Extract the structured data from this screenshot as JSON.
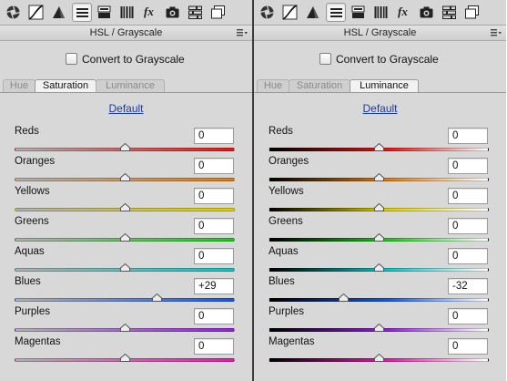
{
  "panels": [
    {
      "id": "left",
      "title": "HSL / Grayscale",
      "convert_label": "Convert to Grayscale",
      "tabs": [
        "Hue",
        "Saturation",
        "Luminance"
      ],
      "active_tab": "Saturation",
      "default_label": "Default",
      "track_style": "saturation",
      "sliders": [
        {
          "label": "Reds",
          "value": "0",
          "fraction": 0.5,
          "hue": "red",
          "color": "#e01818"
        },
        {
          "label": "Oranges",
          "value": "0",
          "fraction": 0.5,
          "hue": "orange",
          "color": "#e07d12"
        },
        {
          "label": "Yellows",
          "value": "0",
          "fraction": 0.5,
          "hue": "yellow",
          "color": "#e0d000"
        },
        {
          "label": "Greens",
          "value": "0",
          "fraction": 0.5,
          "hue": "green",
          "color": "#1cc81c"
        },
        {
          "label": "Aquas",
          "value": "0",
          "fraction": 0.5,
          "hue": "aqua",
          "color": "#12c2c2"
        },
        {
          "label": "Blues",
          "value": "+29",
          "fraction": 0.645,
          "hue": "blue",
          "color": "#1858e0"
        },
        {
          "label": "Purples",
          "value": "0",
          "fraction": 0.5,
          "hue": "purple",
          "color": "#9020d8"
        },
        {
          "label": "Magentas",
          "value": "0",
          "fraction": 0.5,
          "hue": "magenta",
          "color": "#e01ca8"
        }
      ]
    },
    {
      "id": "right",
      "title": "HSL / Grayscale",
      "convert_label": "Convert to Grayscale",
      "tabs": [
        "Hue",
        "Saturation",
        "Luminance"
      ],
      "active_tab": "Luminance",
      "default_label": "Default",
      "track_style": "luminance",
      "sliders": [
        {
          "label": "Reds",
          "value": "0",
          "fraction": 0.5,
          "hue": "red",
          "color": "#e01818"
        },
        {
          "label": "Oranges",
          "value": "0",
          "fraction": 0.5,
          "hue": "orange",
          "color": "#e07d12"
        },
        {
          "label": "Yellows",
          "value": "0",
          "fraction": 0.5,
          "hue": "yellow",
          "color": "#e0d000"
        },
        {
          "label": "Greens",
          "value": "0",
          "fraction": 0.5,
          "hue": "green",
          "color": "#1cc81c"
        },
        {
          "label": "Aquas",
          "value": "0",
          "fraction": 0.5,
          "hue": "aqua",
          "color": "#12c2c2"
        },
        {
          "label": "Blues",
          "value": "-32",
          "fraction": 0.34,
          "hue": "blue",
          "color": "#1858e0"
        },
        {
          "label": "Purples",
          "value": "0",
          "fraction": 0.5,
          "hue": "purple",
          "color": "#9020d8"
        },
        {
          "label": "Magentas",
          "value": "0",
          "fraction": 0.5,
          "hue": "magenta",
          "color": "#e01ca8"
        }
      ]
    }
  ],
  "toolbar_icons": [
    "basic-aperture-icon",
    "tone-curve-icon",
    "detail-triangle-icon",
    "hsl-icon",
    "split-toning-icon",
    "lens-corrections-icon",
    "effects-fx-icon",
    "camera-calibration-icon",
    "presets-icon",
    "snapshots-icon"
  ],
  "toolbar_fx_label": "fx",
  "active_toolbar_icon": "hsl-icon"
}
